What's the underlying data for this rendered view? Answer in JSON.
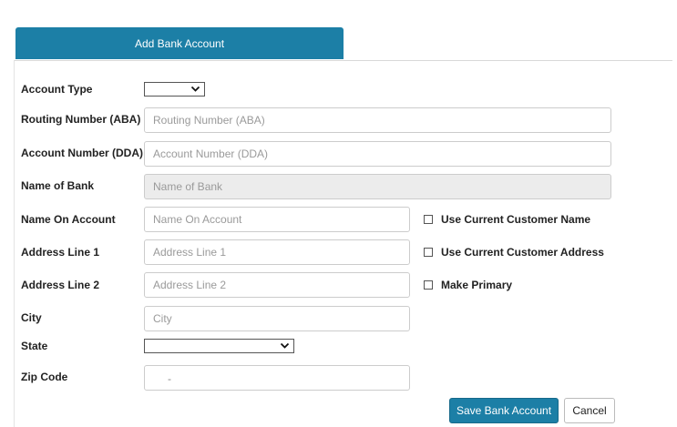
{
  "tabs": {
    "active_label": "Add Bank Account"
  },
  "form": {
    "account_type": {
      "label": "Account Type",
      "value": ""
    },
    "routing_number": {
      "label": "Routing Number (ABA)",
      "placeholder": "Routing Number (ABA)",
      "value": ""
    },
    "account_number": {
      "label": "Account Number (DDA)",
      "placeholder": "Account Number (DDA)",
      "value": ""
    },
    "bank_name": {
      "label": "Name of Bank",
      "placeholder": "Name of Bank",
      "value": ""
    },
    "name_on_account": {
      "label": "Name On Account",
      "placeholder": "Name On Account",
      "value": ""
    },
    "address_line_1": {
      "label": "Address Line 1",
      "placeholder": "Address Line 1",
      "value": ""
    },
    "address_line_2": {
      "label": "Address Line 2",
      "placeholder": "Address Line 2",
      "value": ""
    },
    "city": {
      "label": "City",
      "placeholder": "City",
      "value": ""
    },
    "state": {
      "label": "State",
      "value": ""
    },
    "zip_code": {
      "label": "Zip Code",
      "separator": "-"
    }
  },
  "options": {
    "use_current_customer_name": {
      "label": "Use Current Customer Name",
      "checked": false
    },
    "use_current_customer_address": {
      "label": "Use Current Customer Address",
      "checked": false
    },
    "make_primary": {
      "label": "Make Primary",
      "checked": false
    }
  },
  "actions": {
    "save_label": "Save Bank Account",
    "cancel_label": "Cancel"
  },
  "icons": {
    "select_arrow": "chevron-down-icon",
    "checkbox": "checkbox-icon"
  },
  "colors": {
    "accent": "#1c7fa6",
    "disabled_field": "#ececec",
    "border": "#cccccc"
  }
}
